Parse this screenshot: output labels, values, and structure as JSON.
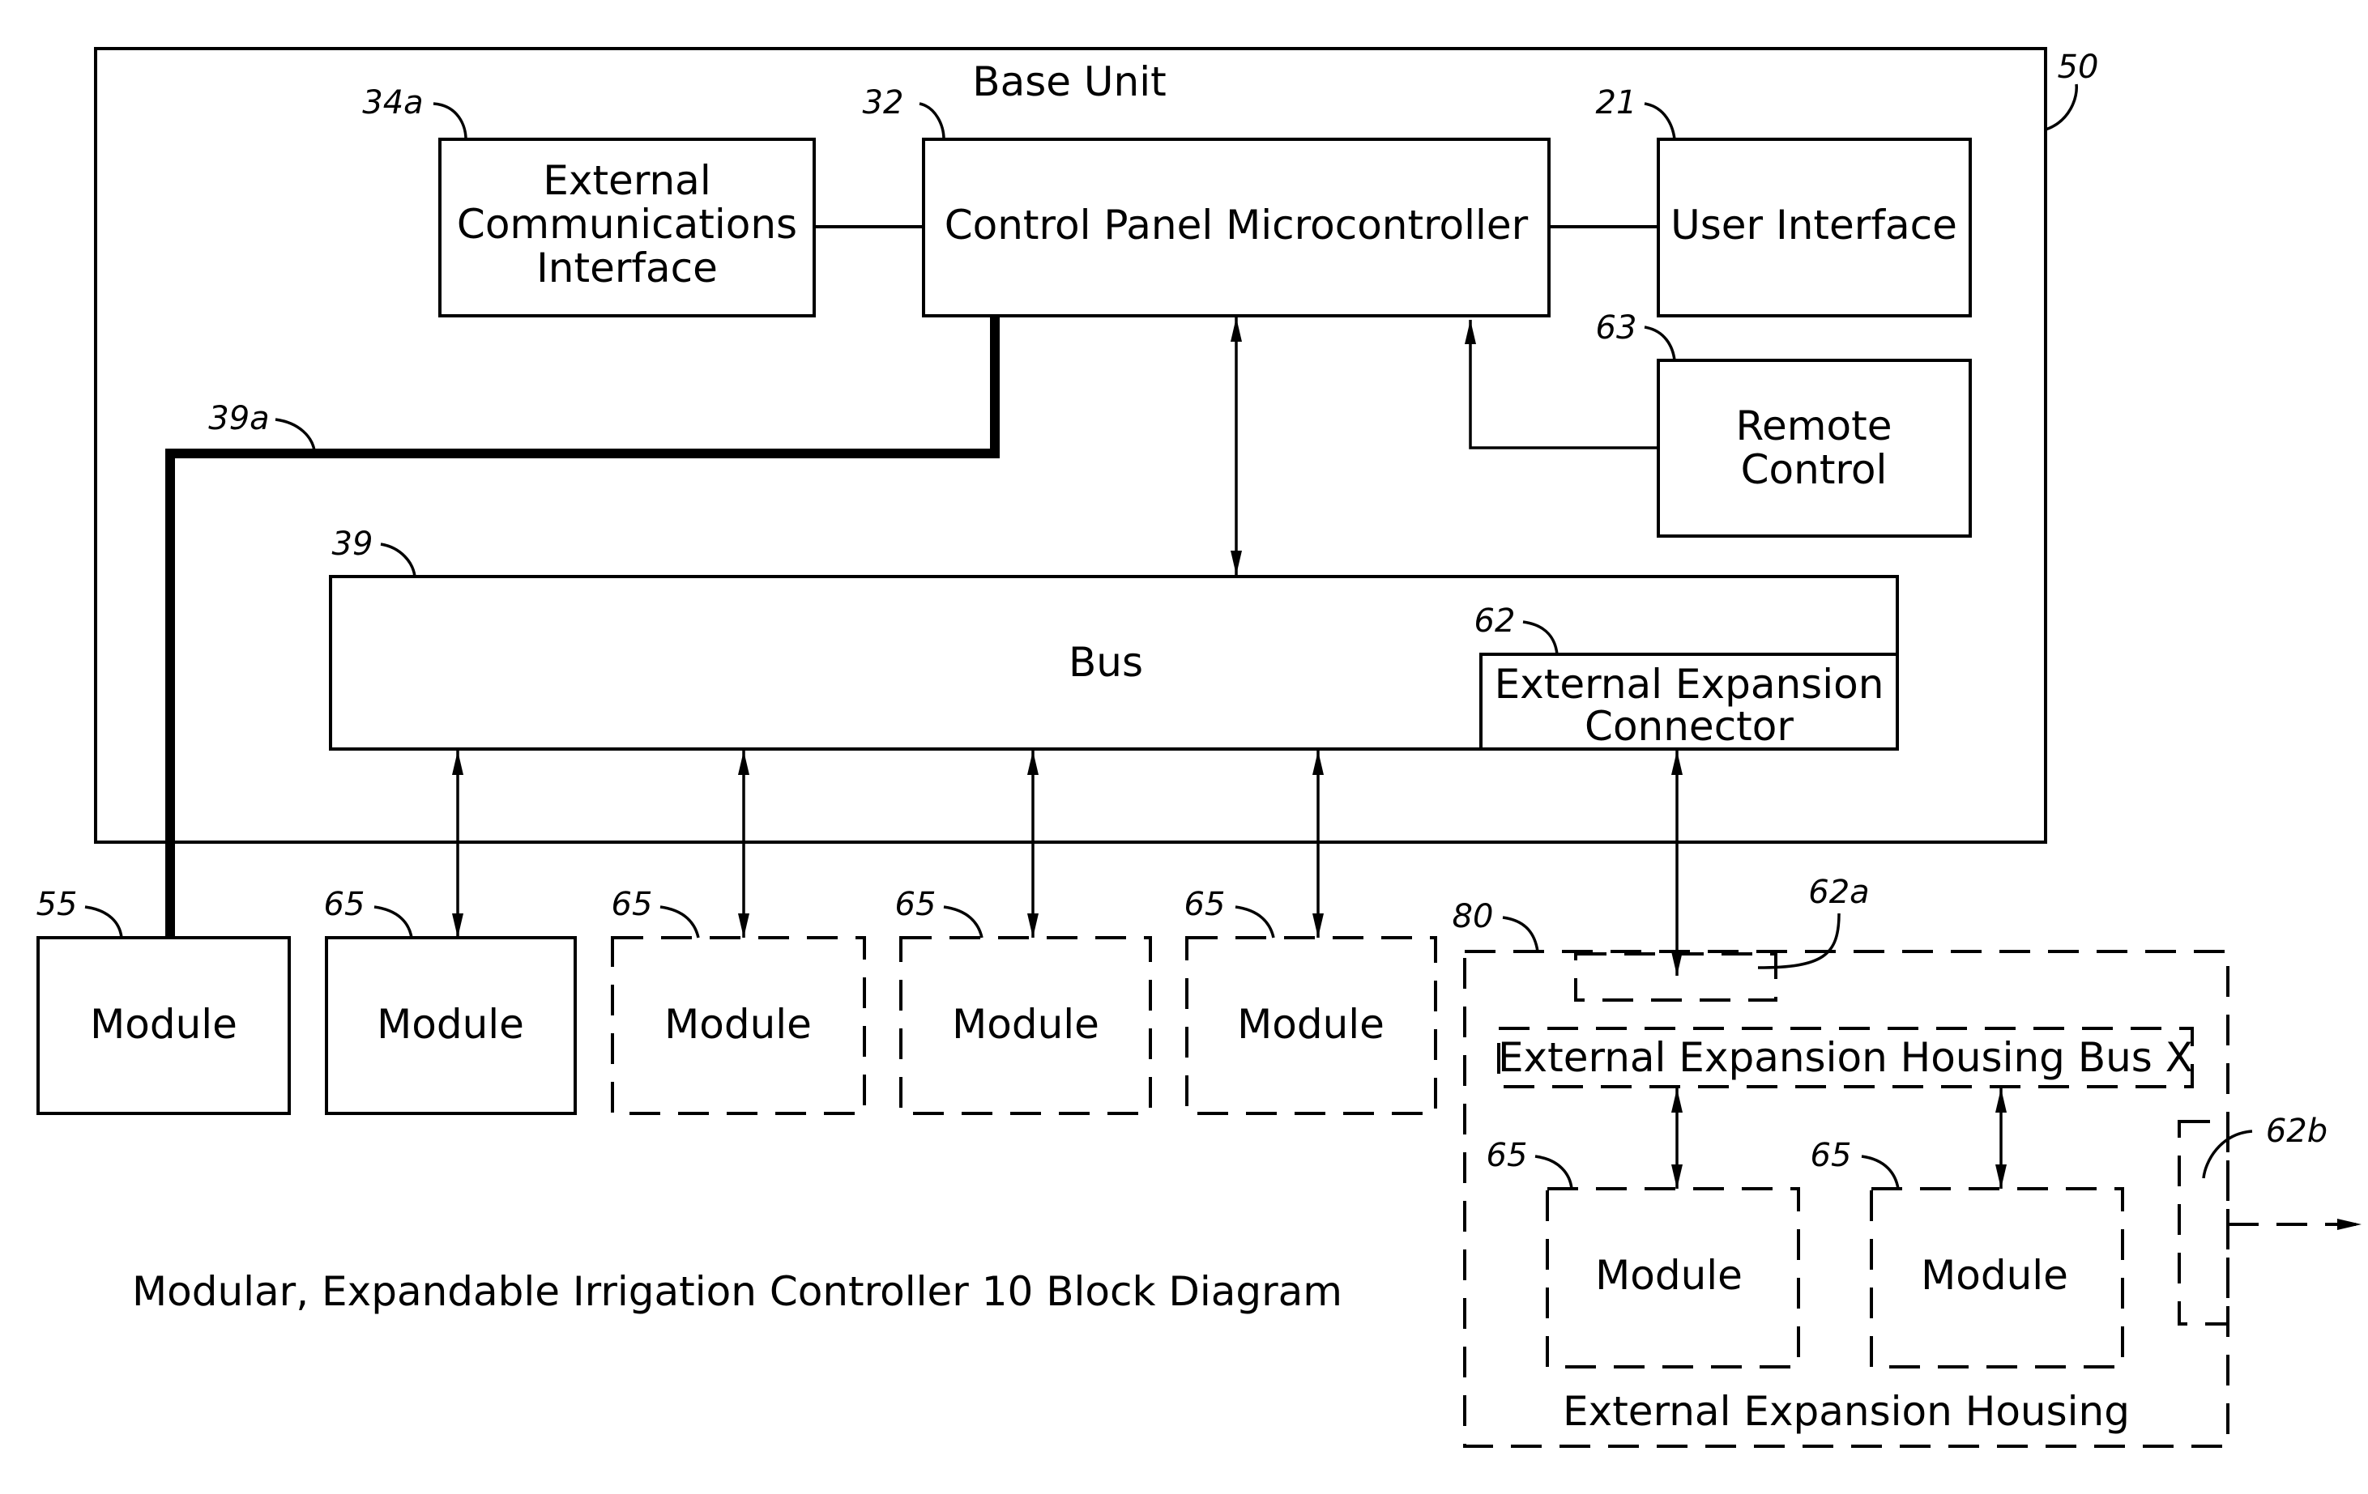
{
  "diagram": {
    "caption": "Modular, Expandable Irrigation Controller 10 Block Diagram",
    "base_unit": {
      "label": "Base Unit",
      "ref": "50"
    },
    "ext_comm": {
      "lines": [
        "External",
        "Communications",
        "Interface"
      ],
      "ref": "34a"
    },
    "cpm": {
      "label": "Control Panel Microcontroller",
      "ref": "32"
    },
    "user_interface": {
      "label": "User Interface",
      "ref": "21"
    },
    "remote_control": {
      "lines": [
        "Remote",
        "Control"
      ],
      "ref": "63"
    },
    "bus": {
      "label": "Bus",
      "ref": "39"
    },
    "ext_connector": {
      "lines": [
        "External Expansion",
        "Connector"
      ],
      "ref": "62"
    },
    "dedicated_line": {
      "ref": "39a"
    },
    "modules": [
      {
        "label": "Module",
        "ref": "55",
        "style": "solid"
      },
      {
        "label": "Module",
        "ref": "65",
        "style": "solid"
      },
      {
        "label": "Module",
        "ref": "65",
        "style": "dashed"
      },
      {
        "label": "Module",
        "ref": "65",
        "style": "dashed"
      },
      {
        "label": "Module",
        "ref": "65",
        "style": "dashed"
      }
    ],
    "housing": {
      "label": "External Expansion Housing",
      "ref": "80",
      "connector_in_ref": "62a",
      "connector_out_ref": "62b",
      "bus_label": "External Expansion Housing Bus X",
      "modules": [
        {
          "label": "Module",
          "ref": "65"
        },
        {
          "label": "Module",
          "ref": "65"
        }
      ]
    }
  }
}
